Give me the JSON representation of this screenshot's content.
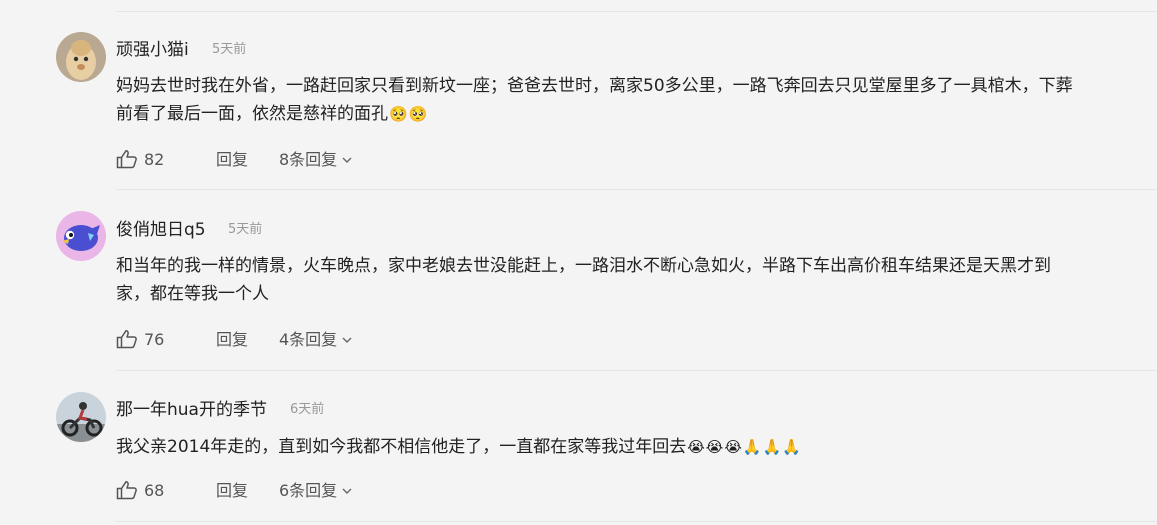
{
  "comments": [
    {
      "username": "顽强小猫i",
      "time": "5天前",
      "line1": "妈妈去世时我在外省，一路赶回家只看到新坟一座；爸爸去世时，离家50多公里，一路飞奔回去只见堂屋里多了一具棺木，下葬",
      "line2": "前看了最后一面，依然是慈祥的面孔",
      "emojis": [
        "🥺",
        "🥺"
      ],
      "likes": "82",
      "reply_label": "回复",
      "replies_label": "8条回复"
    },
    {
      "username": "俊俏旭日q5",
      "time": "5天前",
      "line1": "和当年的我一样的情景，火车晚点，家中老娘去世没能赶上，一路泪水不断心急如火，半路下车出高价租车结果还是天黑才到",
      "line2": "家，都在等我一个人",
      "emojis": [],
      "likes": "76",
      "reply_label": "回复",
      "replies_label": "4条回复"
    },
    {
      "username": "那一年hua开的季节",
      "time": "6天前",
      "line1": "我父亲2014年走的，直到如今我都不相信他走了，一直都在家等我过年回去",
      "line2": "",
      "emojis": [
        "😭",
        "😭",
        "😭",
        "🙏",
        "🙏",
        "🙏"
      ],
      "likes": "68",
      "reply_label": "回复",
      "replies_label": "6条回复"
    }
  ]
}
